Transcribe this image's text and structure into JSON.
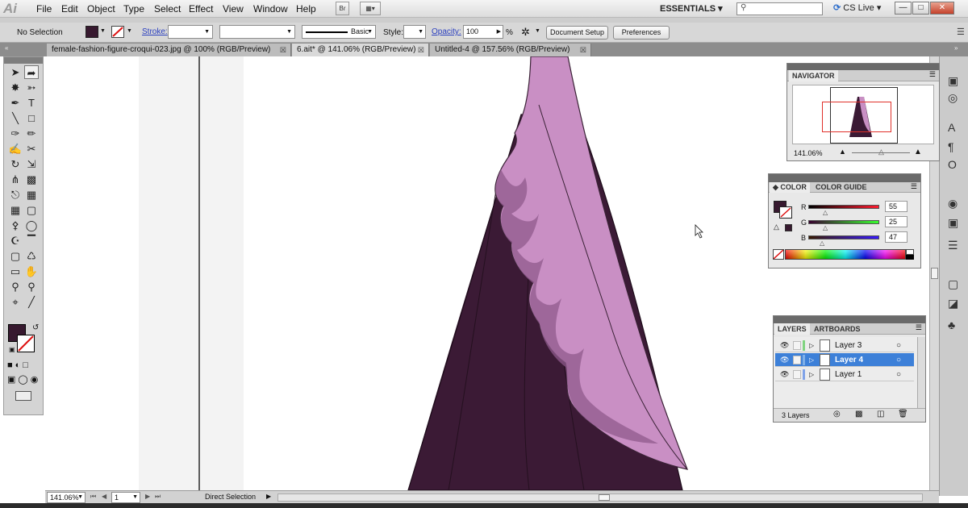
{
  "app": {
    "logo": "Ai"
  },
  "menu": [
    "File",
    "Edit",
    "Object",
    "Type",
    "Select",
    "Effect",
    "View",
    "Window",
    "Help"
  ],
  "menubar": {
    "bridge": "Br",
    "workspace": "ESSENTIALS",
    "cs_live": "CS Live",
    "win_min": "—",
    "win_max": "□",
    "win_close": "✕"
  },
  "control": {
    "selection": "No Selection",
    "stroke_label": "Stroke:",
    "brush": "Basic",
    "style_label": "Style:",
    "opacity_label": "Opacity:",
    "opacity_value": "100",
    "percent": "%",
    "doc_setup": "Document Setup",
    "preferences": "Preferences"
  },
  "tabs": [
    {
      "label": "female-fashion-figure-croqui-023.jpg @ 100% (RGB/Preview)",
      "active": false
    },
    {
      "label": "6.ait* @ 141.06% (RGB/Preview)",
      "active": true
    },
    {
      "label": "Untitled-4 @ 157.56% (RGB/Preview)",
      "active": false
    }
  ],
  "navigator": {
    "title": "NAVIGATOR",
    "zoom": "141.06%"
  },
  "color": {
    "tab1": "COLOR",
    "tab2": "COLOR GUIDE",
    "r_label": "R",
    "g_label": "G",
    "b_label": "B",
    "r": "55",
    "g": "25",
    "b": "47",
    "fill": "#37192f"
  },
  "layers": {
    "tab1": "LAYERS",
    "tab2": "ARTBOARDS",
    "items": [
      "Layer 3",
      "Layer 4",
      "Layer 1"
    ],
    "selected": 1,
    "count": "3 Layers"
  },
  "status": {
    "zoom": "141.06%",
    "page": "1",
    "tool": "Direct Selection"
  },
  "colors": {
    "dress_dark": "#3b1a35",
    "dress_light": "#c98fc4",
    "dress_shadow": "#8f5a8c",
    "selection_blue": "#3d80d8"
  }
}
